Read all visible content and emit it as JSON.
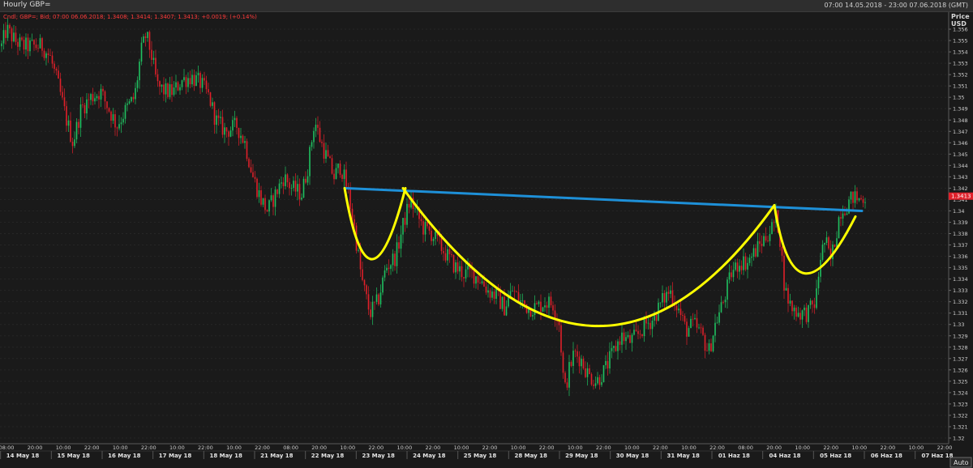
{
  "window": {
    "title": "Hourly GBP=",
    "range": "07:00 14.05.2018 - 23:00 07.06.2018 (GMT)"
  },
  "legend": "Cndl; GBP=; Bid; 07:00 06.06.2018; 1.3408; 1.3414; 1.3407; 1.3413; +0.0019; (+0.14%)",
  "legend_change": "+0.0019; (+0.14%)",
  "price_header": [
    "Price",
    "USD"
  ],
  "auto_button": "Auto",
  "colors": {
    "background": "#1a1a1a",
    "up_candle": "#20c060",
    "down_candle": "#e0202a",
    "neckline": "#1e90d8",
    "pattern": "#ffff00",
    "current_price_tag": "#e0202a"
  },
  "chart_data": {
    "type": "candlestick",
    "title": "Hourly GBP=",
    "ylabel": "Price USD",
    "ylim": [
      1.3195,
      1.3575
    ],
    "y_ticks": [
      "1.32",
      "1.321",
      "1.322",
      "1.323",
      "1.324",
      "1.325",
      "1.326",
      "1.327",
      "1.328",
      "1.329",
      "1.33",
      "1.331",
      "1.332",
      "1.333",
      "1.334",
      "1.335",
      "1.336",
      "1.337",
      "1.338",
      "1.339",
      "1.34",
      "1.341",
      "1.342",
      "1.343",
      "1.344",
      "1.345",
      "1.346",
      "1.347",
      "1.348",
      "1.349",
      "1.35",
      "1.351",
      "1.352",
      "1.353",
      "1.354",
      "1.355",
      "1.356"
    ],
    "current_price": "1.3413",
    "x_time_labels": [
      "08:00",
      "20:00",
      "10:00",
      "22:00",
      "10:00",
      "22:00",
      "10:00",
      "22:00",
      "10:00",
      "22:00",
      "08:00",
      "20:00",
      "10:00",
      "22:00",
      "10:00",
      "22:00",
      "10:00",
      "22:00",
      "10:00",
      "22:00",
      "10:00",
      "22:00",
      "10:00",
      "22:00",
      "10:00",
      "22:00",
      "08:00",
      "20:00",
      "10:00",
      "22:00",
      "10:00",
      "22:00",
      "10:00",
      "22:00"
    ],
    "x_date_labels": [
      "14 May 18",
      "15 May 18",
      "16 May 18",
      "17 May 18",
      "18 May 18",
      "21 May 18",
      "22 May 18",
      "23 May 18",
      "24 May 18",
      "25 May 18",
      "28 May 18",
      "29 May 18",
      "30 May 18",
      "31 May 18",
      "01 Haz 18",
      "04 Haz 18",
      "05 Haz 18",
      "06 Haz 18",
      "07 Haz 18"
    ],
    "path": [
      [
        0,
        1.354
      ],
      [
        8,
        1.356
      ],
      [
        18,
        1.355
      ],
      [
        28,
        1.3545
      ],
      [
        40,
        1.3545
      ],
      [
        52,
        1.3545
      ],
      [
        62,
        1.3535
      ],
      [
        72,
        1.351
      ],
      [
        82,
        1.348
      ],
      [
        90,
        1.346
      ],
      [
        100,
        1.349
      ],
      [
        112,
        1.35
      ],
      [
        124,
        1.3505
      ],
      [
        134,
        1.349
      ],
      [
        144,
        1.3475
      ],
      [
        156,
        1.349
      ],
      [
        166,
        1.35
      ],
      [
        174,
        1.354
      ],
      [
        180,
        1.3555
      ],
      [
        186,
        1.354
      ],
      [
        194,
        1.351
      ],
      [
        204,
        1.3505
      ],
      [
        214,
        1.3505
      ],
      [
        224,
        1.3515
      ],
      [
        236,
        1.3518
      ],
      [
        248,
        1.3512
      ],
      [
        258,
        1.35
      ],
      [
        266,
        1.348
      ],
      [
        278,
        1.347
      ],
      [
        292,
        1.3475
      ],
      [
        302,
        1.346
      ],
      [
        312,
        1.343
      ],
      [
        322,
        1.341
      ],
      [
        330,
        1.34
      ],
      [
        340,
        1.3415
      ],
      [
        350,
        1.343
      ],
      [
        360,
        1.342
      ],
      [
        372,
        1.3415
      ],
      [
        380,
        1.344
      ],
      [
        388,
        1.348
      ],
      [
        396,
        1.346
      ],
      [
        404,
        1.3445
      ],
      [
        412,
        1.343
      ],
      [
        420,
        1.344
      ],
      [
        428,
        1.342
      ],
      [
        436,
        1.339
      ],
      [
        446,
        1.334
      ],
      [
        456,
        1.331
      ],
      [
        466,
        1.332
      ],
      [
        476,
        1.335
      ],
      [
        488,
        1.336
      ],
      [
        498,
        1.339
      ],
      [
        506,
        1.341
      ],
      [
        512,
        1.34
      ],
      [
        522,
        1.3385
      ],
      [
        532,
        1.338
      ],
      [
        542,
        1.337
      ],
      [
        552,
        1.336
      ],
      [
        562,
        1.335
      ],
      [
        572,
        1.3345
      ],
      [
        582,
        1.3345
      ],
      [
        592,
        1.334
      ],
      [
        602,
        1.333
      ],
      [
        612,
        1.3325
      ],
      [
        622,
        1.3315
      ],
      [
        632,
        1.333
      ],
      [
        642,
        1.332
      ],
      [
        652,
        1.3315
      ],
      [
        662,
        1.3315
      ],
      [
        672,
        1.332
      ],
      [
        682,
        1.3318
      ],
      [
        690,
        1.33
      ],
      [
        696,
        1.324
      ],
      [
        702,
        1.326
      ],
      [
        708,
        1.3275
      ],
      [
        716,
        1.327
      ],
      [
        726,
        1.3255
      ],
      [
        736,
        1.325
      ],
      [
        746,
        1.326
      ],
      [
        756,
        1.3275
      ],
      [
        766,
        1.329
      ],
      [
        776,
        1.3285
      ],
      [
        786,
        1.329
      ],
      [
        796,
        1.33
      ],
      [
        806,
        1.3305
      ],
      [
        816,
        1.332
      ],
      [
        826,
        1.333
      ],
      [
        836,
        1.3315
      ],
      [
        846,
        1.3295
      ],
      [
        856,
        1.33
      ],
      [
        866,
        1.329
      ],
      [
        874,
        1.3275
      ],
      [
        882,
        1.33
      ],
      [
        892,
        1.332
      ],
      [
        902,
        1.3345
      ],
      [
        912,
        1.3355
      ],
      [
        922,
        1.3355
      ],
      [
        932,
        1.3365
      ],
      [
        942,
        1.3375
      ],
      [
        952,
        1.3385
      ],
      [
        958,
        1.3395
      ],
      [
        962,
        1.3375
      ],
      [
        968,
        1.333
      ],
      [
        976,
        1.3315
      ],
      [
        986,
        1.331
      ],
      [
        996,
        1.331
      ],
      [
        1006,
        1.332
      ],
      [
        1012,
        1.336
      ],
      [
        1018,
        1.3375
      ],
      [
        1024,
        1.3355
      ],
      [
        1030,
        1.3375
      ],
      [
        1036,
        1.34
      ],
      [
        1044,
        1.3405
      ],
      [
        1052,
        1.3412
      ],
      [
        1060,
        1.341
      ],
      [
        1068,
        1.3413
      ]
    ],
    "neckline": {
      "x": [
        425,
        1063
      ],
      "y": [
        1.342,
        1.34
      ]
    },
    "pattern_curves": [
      [
        [
          425,
          1.342
        ],
        [
          455,
          1.3295
        ],
        [
          500,
          1.342
        ]
      ],
      [
        [
          497,
          1.342
        ],
        [
          735,
          1.3185
        ],
        [
          955,
          1.3405
        ]
      ],
      [
        [
          955,
          1.3405
        ],
        [
          980,
          1.329
        ],
        [
          1055,
          1.3395
        ]
      ]
    ]
  }
}
